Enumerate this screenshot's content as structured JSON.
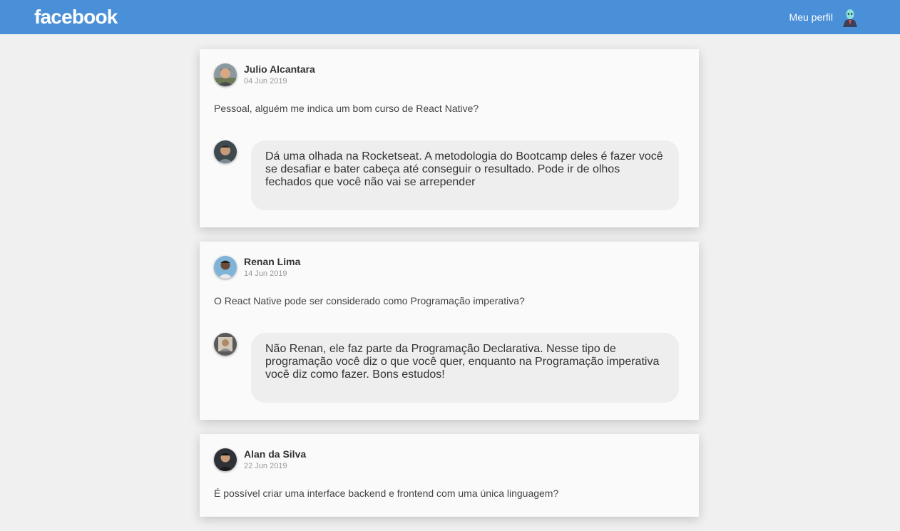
{
  "header": {
    "logo": "facebook",
    "profile_label": "Meu perfil",
    "profile_icon": "profile-avatar-icon"
  },
  "colors": {
    "topbar": "#4a90d9",
    "background": "#f0f0f0",
    "card": "#fafafa",
    "bubble": "#eeeeee"
  },
  "posts": [
    {
      "author": "Julio Alcantara",
      "date": "04 Jun 2019",
      "content": "Pessoal, alguém me indica um bom curso de React Native?",
      "comment": "Dá uma olhada na Rocketseat. A metodologia do Bootcamp deles é fazer você se desafiar e bater cabeça até conseguir o resultado. Pode ir de olhos fechados que você não vai se arrepender"
    },
    {
      "author": "Renan Lima",
      "date": "14 Jun 2019",
      "content": "O React Native pode ser considerado como Programação imperativa?",
      "comment": "Não Renan, ele faz parte da Programação Declarativa. Nesse tipo de programação você diz o que você quer, enquanto na Programação imperativa você diz como fazer. Bons estudos!"
    },
    {
      "author": "Alan da Silva",
      "date": "22 Jun 2019",
      "content": "É possível criar uma interface backend e frontend com uma única linguagem?"
    }
  ]
}
